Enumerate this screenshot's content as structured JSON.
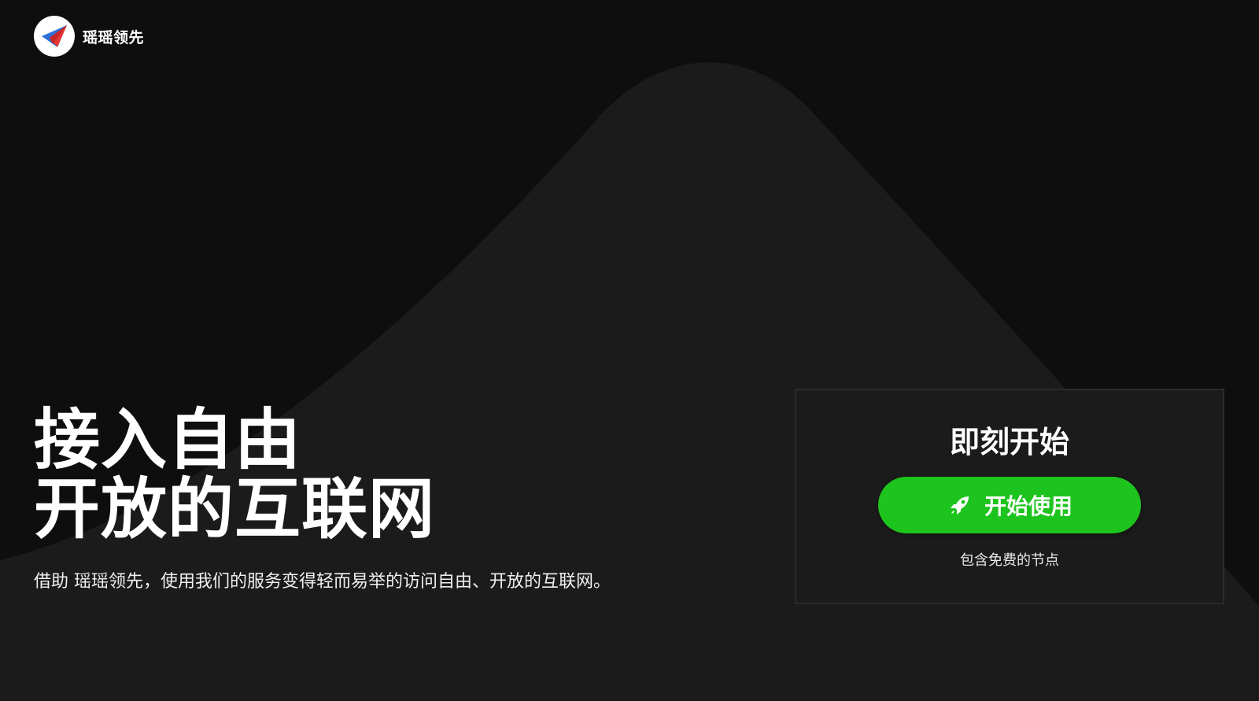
{
  "header": {
    "brand_name": "瑶瑶领先",
    "logo_icon": "paper-plane-icon"
  },
  "hero": {
    "title_line1": "接入自由",
    "title_line2": "开放的互联网",
    "subtitle": "借助 瑶瑶领先，使用我们的服务变得轻而易举的访问自由、开放的互联网。"
  },
  "card": {
    "title": "即刻开始",
    "cta_label": "开始使用",
    "cta_icon": "rocket-icon",
    "note": "包含免费的节点"
  },
  "colors": {
    "background": "#0e0e0e",
    "shape": "#1b1b1b",
    "accent": "#1ec41e",
    "logo_red": "#e53935",
    "logo_blue": "#2f6fd6"
  }
}
